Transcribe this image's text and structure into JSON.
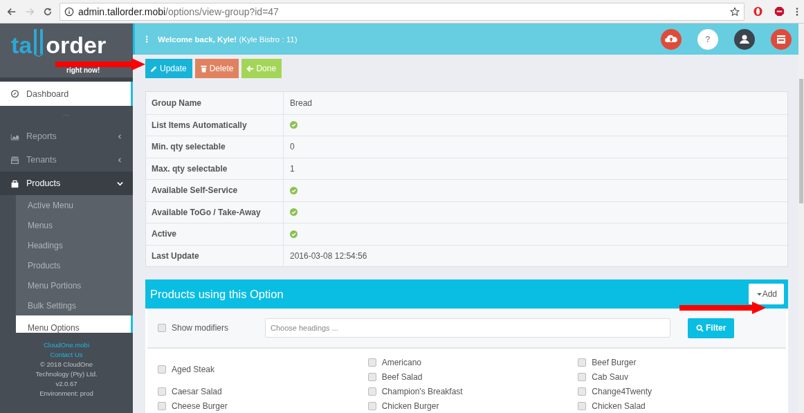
{
  "browser": {
    "url_host": "admin.tallorder.mobi",
    "url_path": "/options/view-group?id=47",
    "forward_disabled": true
  },
  "sidebar": {
    "logo": {
      "word_start": "ta",
      "word_end": "order",
      "tagline": "right now!"
    },
    "items": [
      {
        "label": "Dashboard",
        "selected": true
      },
      {
        "label": "Reports",
        "selected": false,
        "expanded": false
      },
      {
        "label": "Tenants",
        "selected": false,
        "expanded": false
      },
      {
        "label": "Products",
        "selected": false,
        "expanded": true,
        "children": [
          {
            "label": "Active Menu",
            "selected": false
          },
          {
            "label": "Menus",
            "selected": false
          },
          {
            "label": "Headings",
            "selected": false
          },
          {
            "label": "Products",
            "selected": false
          },
          {
            "label": "Menu Portions",
            "selected": false
          },
          {
            "label": "Bulk Settings",
            "selected": false
          },
          {
            "label": "Menu Options",
            "selected": true
          }
        ]
      }
    ],
    "footer": {
      "links": [
        "CloudOne.mobi",
        "Contact Us"
      ],
      "lines": [
        "© 2018 CloudOne",
        "Technology (Pty) Ltd.",
        "v2.0.67",
        "Environment: prod"
      ]
    }
  },
  "header": {
    "welcome": "**Welcome back, Kyle!** (Kyle Bistro : 11)",
    "help_label": "?"
  },
  "actions": [
    {
      "label": "Update",
      "kind": "update"
    },
    {
      "label": "Delete",
      "kind": "delete"
    },
    {
      "label": "Done",
      "kind": "done"
    }
  ],
  "details": [
    {
      "label": "Group Name",
      "kind": "text",
      "value": "Bread"
    },
    {
      "label": "List Items Automatically",
      "kind": "check",
      "checked": true
    },
    {
      "label": "Min. qty selectable",
      "kind": "text",
      "value": "0"
    },
    {
      "label": "Max. qty selectable",
      "kind": "text",
      "value": "1"
    },
    {
      "label": "Available Self-Service",
      "kind": "check",
      "checked": true
    },
    {
      "label": "Available ToGo / Take-Away",
      "kind": "check",
      "checked": true
    },
    {
      "label": "Active",
      "kind": "check",
      "checked": true
    },
    {
      "label": "Last Update",
      "kind": "text",
      "value": "2016-03-08 12:54:56"
    }
  ],
  "products_panel": {
    "title": "Products using this Option",
    "add_label": "Add",
    "show_modifiers": {
      "label": "Show modifiers",
      "checked": false
    },
    "headings_placeholder": "Choose headings ...",
    "filter_label": "Filter",
    "columns": [
      [
        {
          "label": "Aged Steak",
          "checked": false
        },
        {
          "label": "Caesar Salad",
          "checked": false
        },
        {
          "label": "Cheese Burger",
          "checked": false
        }
      ],
      [
        {
          "label": "Americano",
          "checked": false
        },
        {
          "label": "Beef Salad",
          "checked": false
        },
        {
          "label": "Champion's Breakfast",
          "checked": false
        },
        {
          "label": "Chicken Burger",
          "checked": false
        }
      ],
      [
        {
          "label": "Beef Burger",
          "checked": false
        },
        {
          "label": "Cab Sauv",
          "checked": false
        },
        {
          "label": "Change4Twenty",
          "checked": false
        },
        {
          "label": "Chicken Salad",
          "checked": false
        }
      ]
    ]
  }
}
